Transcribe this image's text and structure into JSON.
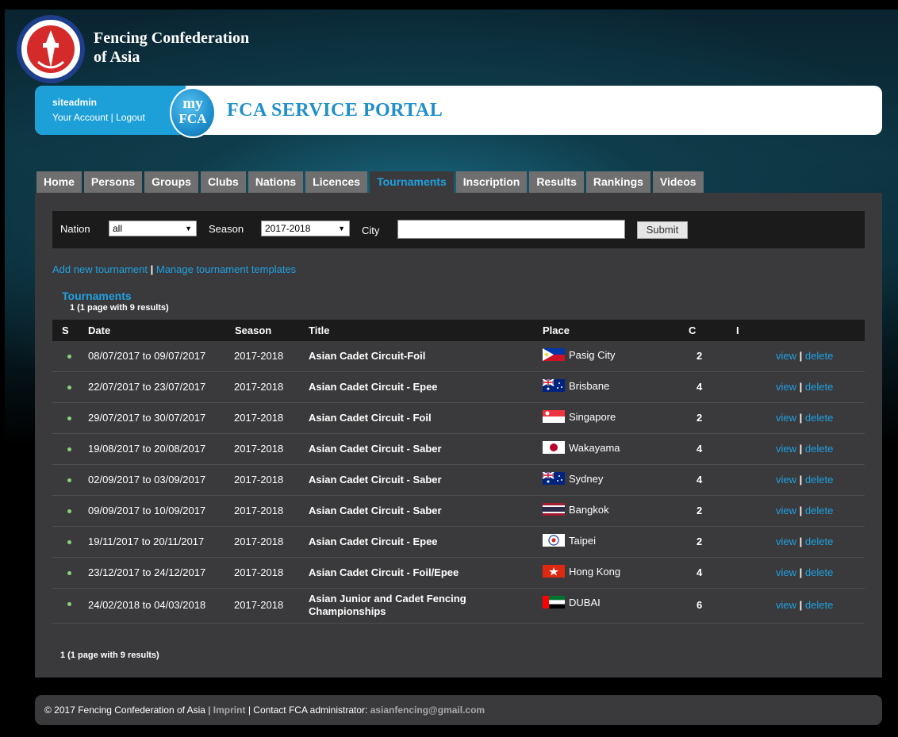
{
  "header": {
    "org_name_line1": "Fencing Confederation",
    "org_name_line2": "of Asia",
    "logo_text": "FENCING CONFEDERATION OF ASIA",
    "portal_badge_line1": "my",
    "portal_badge_line2": "FCA",
    "portal_title": "FCA SERVICE PORTAL"
  },
  "user": {
    "name": "siteadmin",
    "account_link": "Your Account",
    "separator": "|",
    "logout_link": "Logout"
  },
  "tabs": [
    {
      "label": "Home"
    },
    {
      "label": "Persons"
    },
    {
      "label": "Groups"
    },
    {
      "label": "Clubs"
    },
    {
      "label": "Nations"
    },
    {
      "label": "Licences"
    },
    {
      "label": "Tournaments",
      "active": true
    },
    {
      "label": "Inscription"
    },
    {
      "label": "Results"
    },
    {
      "label": "Rankings"
    },
    {
      "label": "Videos"
    }
  ],
  "filter": {
    "nation_label": "Nation",
    "nation_value": "all",
    "season_label": "Season",
    "season_value": "2017-2018",
    "city_label": "City",
    "city_value": "",
    "submit_label": "Submit"
  },
  "actions": {
    "add_tournament": "Add new tournament",
    "separator": "|",
    "manage_templates": "Manage tournament templates"
  },
  "section": {
    "title": "Tournaments",
    "summary": "1  (1 page with 9 results)"
  },
  "table": {
    "columns": [
      "S",
      "Date",
      "Season",
      "Title",
      "Place",
      "C",
      "I"
    ],
    "row_actions": {
      "view": "view",
      "separator": "|",
      "delete": "delete"
    },
    "rows": [
      {
        "date": "08/07/2017 to 09/07/2017",
        "season": "2017-2018",
        "title": "Asian Cadet Circuit-Foil",
        "place": "Pasig City",
        "flag": "philippines",
        "c": "2"
      },
      {
        "date": "22/07/2017 to 23/07/2017",
        "season": "2017-2018",
        "title": "Asian Cadet Circuit - Epee",
        "place": "Brisbane",
        "flag": "australia",
        "c": "4"
      },
      {
        "date": "29/07/2017 to 30/07/2017",
        "season": "2017-2018",
        "title": "Asian Cadet Circuit - Foil",
        "place": "Singapore",
        "flag": "singapore",
        "c": "2"
      },
      {
        "date": "19/08/2017 to 20/08/2017",
        "season": "2017-2018",
        "title": "Asian Cadet Circuit - Saber",
        "place": "Wakayama",
        "flag": "japan",
        "c": "4"
      },
      {
        "date": "02/09/2017 to 03/09/2017",
        "season": "2017-2018",
        "title": "Asian Cadet Circuit - Saber",
        "place": "Sydney",
        "flag": "australia",
        "c": "4"
      },
      {
        "date": "09/09/2017 to 10/09/2017",
        "season": "2017-2018",
        "title": "Asian Cadet Circuit - Saber",
        "place": "Bangkok",
        "flag": "thailand",
        "c": "2"
      },
      {
        "date": "19/11/2017 to 20/11/2017",
        "season": "2017-2018",
        "title": "Asian Cadet Circuit - Epee",
        "place": "Taipei",
        "flag": "chinese-taipei",
        "c": "2"
      },
      {
        "date": "23/12/2017 to 24/12/2017",
        "season": "2017-2018",
        "title": "Asian Cadet Circuit - Foil/Epee",
        "place": "Hong Kong",
        "flag": "hong-kong",
        "c": "4"
      },
      {
        "date": "24/02/2018 to 04/03/2018",
        "season": "2017-2018",
        "title": "Asian Junior and Cadet Fencing Championships",
        "place": "DUBAI",
        "flag": "uae",
        "c": "6"
      }
    ]
  },
  "pagination": {
    "summary": "1  (1 page with 9 results)"
  },
  "footer": {
    "copyright": "© 2017 Fencing Confederation of Asia",
    "separator": "|",
    "imprint": "Imprint",
    "contact_label": "Contact FCA administrator:",
    "contact_email": "asianfencing@gmail.com"
  },
  "colors": {
    "accent": "#1fa0e0",
    "user_box": "#1da0d8",
    "tab": "#6f6f6f",
    "panel": "#3a3a3c",
    "status_dot": "#8bd17c"
  },
  "icons": {
    "logo": "fca-logo-icon",
    "select_arrow": "caret-down-icon",
    "status": "status-dot-icon"
  }
}
